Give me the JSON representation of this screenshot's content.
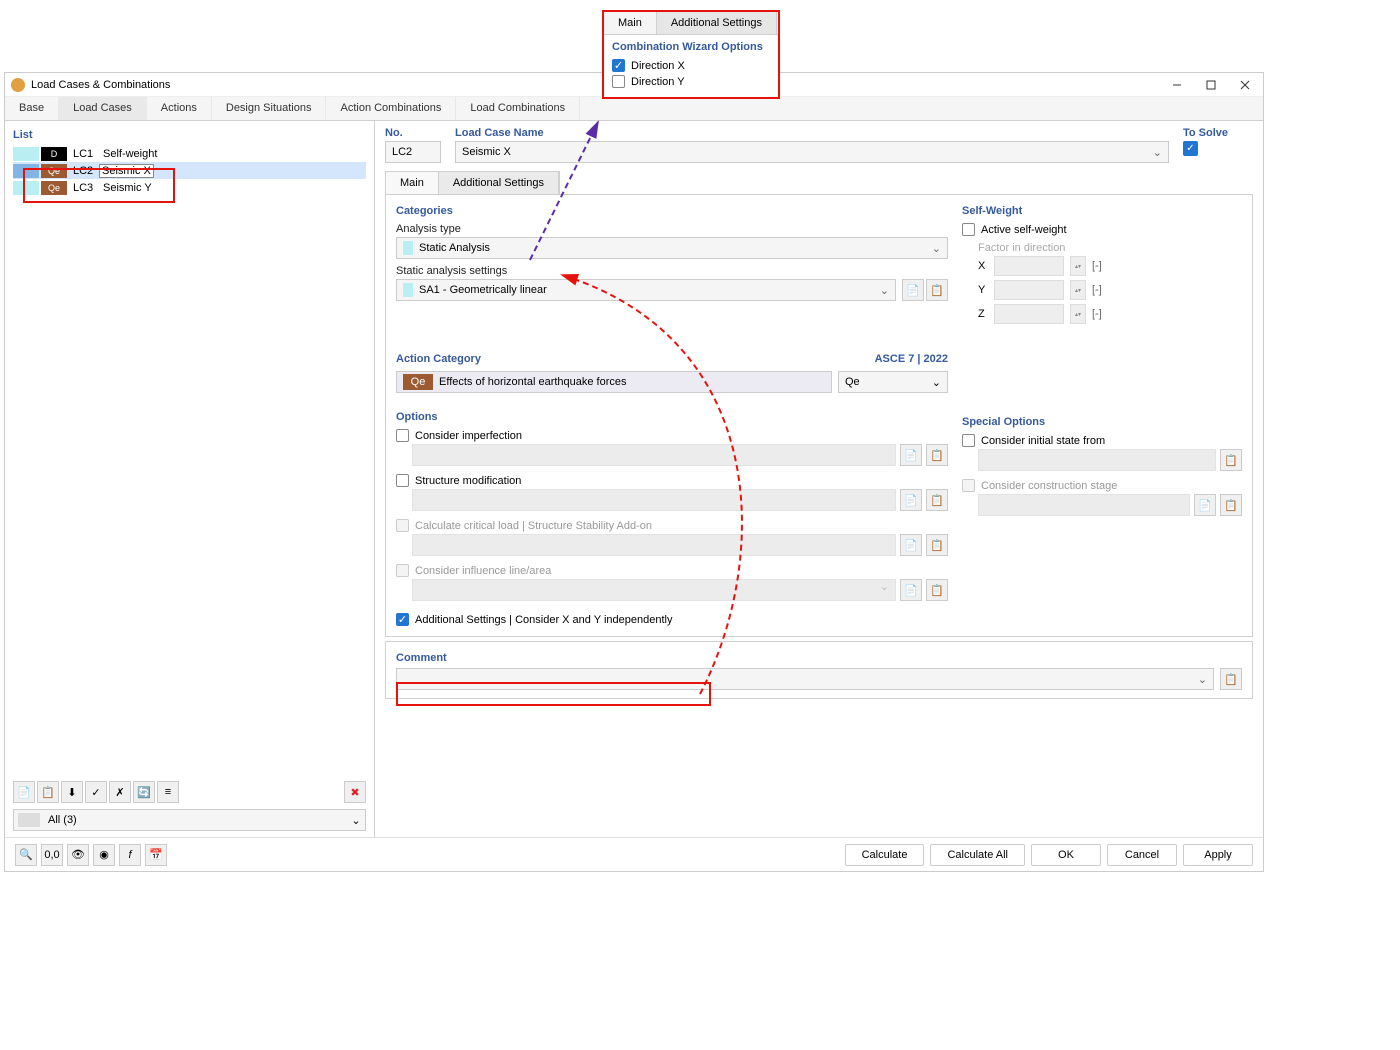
{
  "window": {
    "title": "Load Cases & Combinations"
  },
  "top_tabs": [
    "Base",
    "Load Cases",
    "Actions",
    "Design Situations",
    "Action Combinations",
    "Load Combinations"
  ],
  "active_top_tab": 1,
  "list": {
    "header": "List",
    "rows": [
      {
        "badge1": "",
        "badge2": "D",
        "lc": "LC1",
        "name": "Self-weight",
        "badge2class": "black"
      },
      {
        "badge1": "",
        "badge2": "Qe",
        "lc": "LC2",
        "name": "Seismic X",
        "badge2class": "brown",
        "selected": true
      },
      {
        "badge1": "",
        "badge2": "Qe",
        "lc": "LC3",
        "name": "Seismic Y",
        "badge2class": "brown"
      }
    ],
    "filter": "All (3)"
  },
  "header": {
    "no_label": "No.",
    "no_value": "LC2",
    "name_label": "Load Case Name",
    "name_value": "Seismic X",
    "solve_label": "To Solve"
  },
  "sub_tabs": {
    "main": "Main",
    "additional": "Additional Settings"
  },
  "categories": {
    "title": "Categories",
    "analysis_type_label": "Analysis type",
    "analysis_type_value": "Static Analysis",
    "static_settings_label": "Static analysis settings",
    "static_settings_value": "SA1 - Geometrically linear"
  },
  "action": {
    "title": "Action Category",
    "ref": "ASCE 7 | 2022",
    "badge": "Qe",
    "desc": "Effects of horizontal earthquake forces",
    "dd": "Qe"
  },
  "options": {
    "title": "Options",
    "imperfection": "Consider imperfection",
    "structure_mod": "Structure modification",
    "critical": "Calculate critical load | Structure Stability Add-on",
    "influence": "Consider influence line/area",
    "additional": "Additional Settings | Consider X and Y independently"
  },
  "selfweight": {
    "title": "Self-Weight",
    "active": "Active self-weight",
    "factor_label": "Factor in direction",
    "axes": [
      "X",
      "Y",
      "Z"
    ],
    "unit": "[-]"
  },
  "special": {
    "title": "Special Options",
    "initial": "Consider initial state from",
    "construction": "Consider construction stage"
  },
  "comment": {
    "title": "Comment"
  },
  "footer": {
    "calculate": "Calculate",
    "calculate_all": "Calculate All",
    "ok": "OK",
    "cancel": "Cancel",
    "apply": "Apply"
  },
  "popup": {
    "tab_main": "Main",
    "tab_additional": "Additional Settings",
    "title": "Combination Wizard Options",
    "dir_x": "Direction X",
    "dir_y": "Direction Y"
  }
}
